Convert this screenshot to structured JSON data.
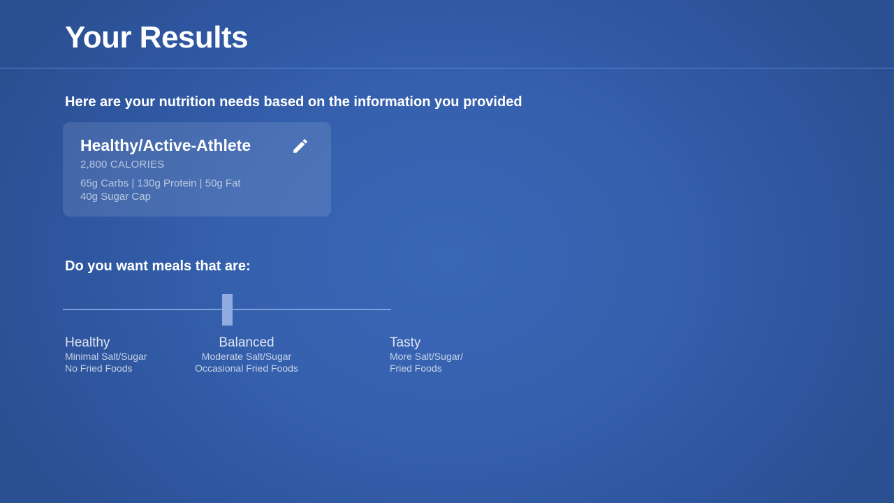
{
  "header": {
    "title": "Your Results"
  },
  "intro": "Here are your nutrition needs based on the information you provided",
  "card": {
    "title": "Healthy/Active-Athlete",
    "edit_icon": "pencil-icon",
    "calories": "2,800 CALORIES",
    "macros": "65g Carbs | 130g Protein | 50g Fat",
    "sugar_cap": "40g Sugar Cap"
  },
  "meals": {
    "question": "Do you want meals that are:",
    "slider": {
      "value": 0.5,
      "selected": "Balanced"
    },
    "options": [
      {
        "name": "Healthy",
        "line1": "Minimal Salt/Sugar",
        "line2": "No Fried Foods"
      },
      {
        "name": "Balanced",
        "line1": "Moderate Salt/Sugar",
        "line2": "Occasional Fried Foods"
      },
      {
        "name": "Tasty",
        "line1": "More Salt/Sugar/",
        "line2": "Fried Foods"
      }
    ]
  },
  "colors": {
    "background": "#3560ad",
    "divider": "#5a86d4",
    "slider_track": "#7da0dc",
    "slider_thumb": "#8fabdf"
  }
}
